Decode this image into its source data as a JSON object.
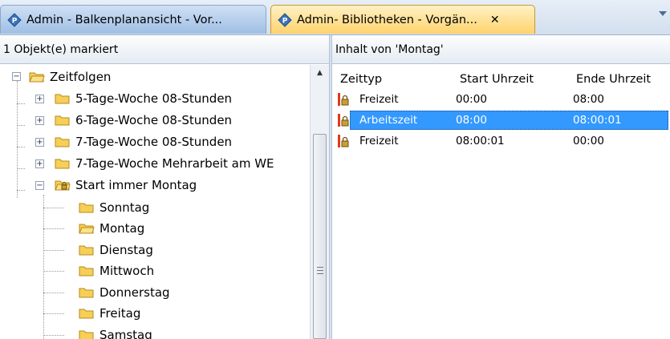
{
  "tabs": [
    {
      "label": "Admin - Balkenplanansicht - Vor...",
      "active": false
    },
    {
      "label": "Admin- Bibliotheken - Vorgän...",
      "active": true,
      "close": "✕"
    }
  ],
  "tree_panel": {
    "status": "1 Objekt(e) markiert",
    "root": {
      "label": "Zeitfolgen",
      "expander": "−"
    },
    "nodes": [
      {
        "label": "5-Tage-Woche 08-Stunden",
        "expander": "+"
      },
      {
        "label": "6-Tage-Woche 08-Stunden",
        "expander": "+"
      },
      {
        "label": "7-Tage-Woche 08-Stunden",
        "expander": "+"
      },
      {
        "label": "7-Tage-Woche Mehrarbeit am WE",
        "expander": "+"
      },
      {
        "label": "Start immer Montag",
        "expander": "−",
        "locked": true
      }
    ],
    "days": [
      "Sonntag",
      "Montag",
      "Dienstag",
      "Mittwoch",
      "Donnerstag",
      "Freitag",
      "Samstag"
    ],
    "selected_day": "Montag"
  },
  "list_panel": {
    "title": "Inhalt von 'Montag'",
    "columns": [
      "Zeittyp",
      "Start Uhrzeit",
      "Ende Uhrzeit"
    ],
    "rows": [
      {
        "type": "Freizeit",
        "start": "00:00",
        "end": "08:00",
        "selected": false
      },
      {
        "type": "Arbeitszeit",
        "start": "08:00",
        "end": "08:00:01",
        "selected": true
      },
      {
        "type": "Freizeit",
        "start": "08:00:01",
        "end": "00:00",
        "selected": false
      }
    ]
  },
  "icons": {
    "tab_icon": "p-logo-icon",
    "folder": "folder-icon",
    "locked_folder": "locked-folder-icon",
    "row_icon": "time-type-lock-icon"
  },
  "colors": {
    "selection": "#3399ff",
    "active_tab": "#ffd36d",
    "inactive_tab": "#9fbfe4",
    "folder": "#f6cf57"
  }
}
